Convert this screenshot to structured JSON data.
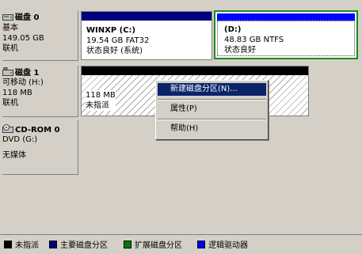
{
  "colors": {
    "unallocated": "#000000",
    "primary_partition": "#00007f",
    "extended_partition": "#008000",
    "logical_drive": "#0000ff",
    "selected_border": "#1a8a1a",
    "menu_highlight": "#0a246a"
  },
  "disks": [
    {
      "name": "磁盘 0",
      "type": "基本",
      "size": "149.05 GB",
      "status": "联机",
      "icon": "hard-disk-icon",
      "volumes": [
        {
          "name": "WINXP  (C:)",
          "size": "19.54 GB FAT32",
          "status": "状态良好 (系统)"
        },
        {
          "name": "(D:)",
          "size": "48.83 GB NTFS",
          "status": "状态良好"
        }
      ]
    },
    {
      "name": "磁盘 1",
      "type": "可移动 (H:)",
      "size": "118 MB",
      "status": "联机",
      "icon": "removable-disk-icon",
      "volumes": [
        {
          "size": "118 MB",
          "status": "未指派"
        }
      ]
    },
    {
      "name": "CD-ROM 0",
      "type": "DVD (G:)",
      "status": "无媒体",
      "icon": "cdrom-icon"
    }
  ],
  "context_menu": {
    "items": [
      {
        "label": "新建磁盘分区(N)...",
        "highlighted": true
      },
      {
        "label": "属性(P)"
      },
      {
        "label": "帮助(H)"
      }
    ]
  },
  "legend": [
    {
      "label": "未指派"
    },
    {
      "label": "主要磁盘分区"
    },
    {
      "label": "扩展磁盘分区"
    },
    {
      "label": "逻辑驱动器"
    }
  ]
}
